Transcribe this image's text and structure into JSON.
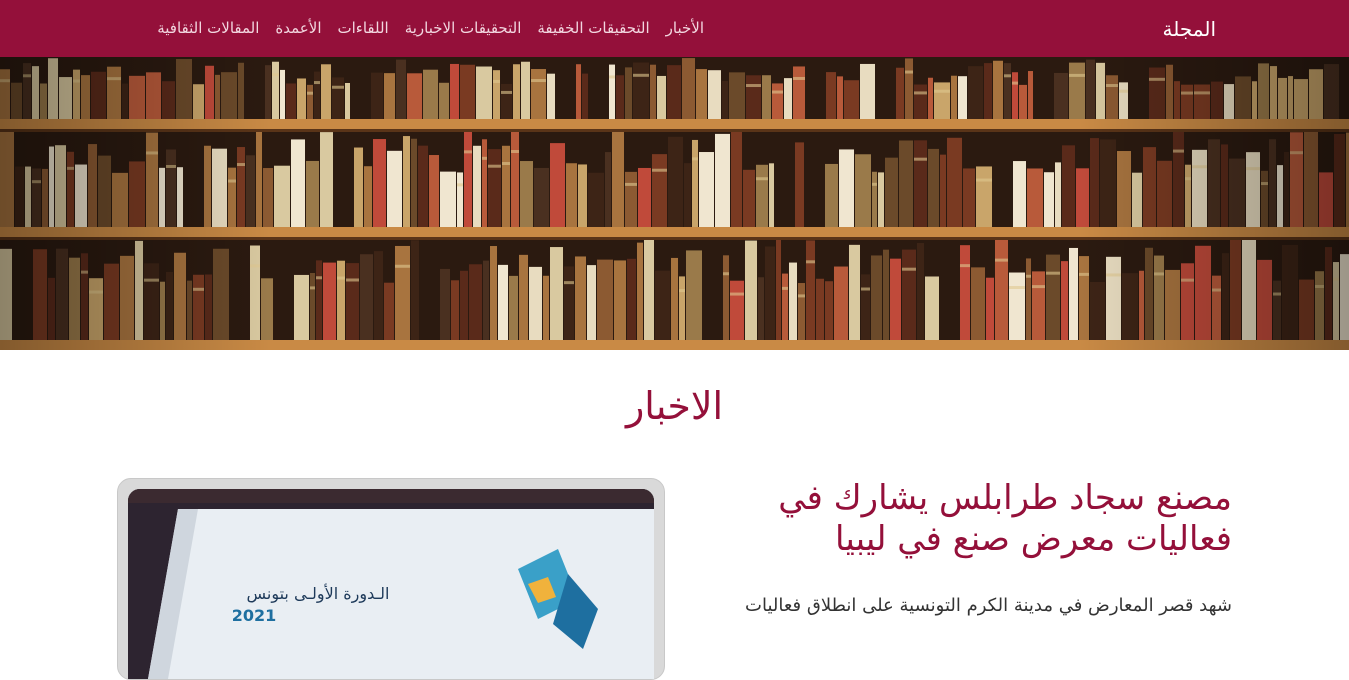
{
  "navbar": {
    "brand": "المجلة",
    "links": [
      {
        "label": "الأخبار"
      },
      {
        "label": "التحقيقات الخفيفة"
      },
      {
        "label": "التحقيقات الاخبارية"
      },
      {
        "label": "اللقاءات"
      },
      {
        "label": "الأعمدة"
      },
      {
        "label": "المقالات الثقافية"
      }
    ]
  },
  "section": {
    "title": "الاخبار"
  },
  "article": {
    "title": "مصنع سجاد طرابلس يشارك في فعاليات معرض صنع في ليبيا",
    "excerpt": "شهد قصر المعارض في مدينة الكرم التونسية على انطلاق فعاليات",
    "photo_text_line1": "الـدورة الأولـى بتونس",
    "photo_text_line2": "2021"
  },
  "colors": {
    "primary": "#94103a",
    "nav_text": "#f2d6df"
  }
}
